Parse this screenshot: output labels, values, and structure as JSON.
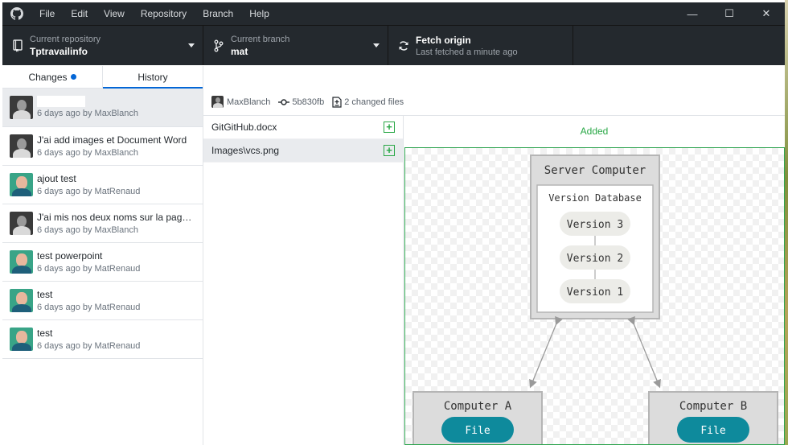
{
  "menu": [
    "File",
    "Edit",
    "View",
    "Repository",
    "Branch",
    "Help"
  ],
  "window_controls": {
    "minimize": "—",
    "maximize": "☐",
    "close": "✕"
  },
  "toolbar": {
    "repo_caption": "Current repository",
    "repo_name": "Tptravailinfo",
    "branch_caption": "Current branch",
    "branch_name": "mat",
    "fetch_title": "Fetch origin",
    "fetch_status": "Last fetched a minute ago"
  },
  "tabs": {
    "changes": "Changes",
    "history": "History",
    "selected": "History"
  },
  "commits": [
    {
      "summary": "",
      "meta": "6 days ago by MaxBlanch",
      "author": "MaxBlanch",
      "selected": true
    },
    {
      "summary": "J'ai add images et Document Word",
      "meta": "6 days ago by MaxBlanch",
      "author": "MaxBlanch"
    },
    {
      "summary": "ajout test",
      "meta": "6 days ago by MatRenaud",
      "author": "MatRenaud"
    },
    {
      "summary": "J'ai mis nos deux noms sur la page ...",
      "meta": "6 days ago by MaxBlanch",
      "author": "MaxBlanch"
    },
    {
      "summary": "test powerpoint",
      "meta": "6 days ago by MatRenaud",
      "author": "MatRenaud"
    },
    {
      "summary": "test",
      "meta": "6 days ago by MatRenaud",
      "author": "MatRenaud"
    },
    {
      "summary": "test",
      "meta": "6 days ago by MatRenaud",
      "author": "MatRenaud"
    }
  ],
  "commit_header": {
    "author": "MaxBlanch",
    "sha": "5b830fb",
    "changed_files": "2 changed files"
  },
  "files": [
    {
      "name": "GitGitHub.docx",
      "status": "+"
    },
    {
      "name": "Images\\vcs.png",
      "status": "+",
      "selected": true
    }
  ],
  "diff": {
    "label": "Added"
  },
  "image": {
    "server_title": "Server Computer",
    "db_title": "Version Database",
    "versions": [
      "Version 3",
      "Version 2",
      "Version 1"
    ],
    "computer_a": "Computer A",
    "computer_b": "Computer B",
    "file_label": "File"
  },
  "colors": {
    "accent": "#0366d6",
    "added": "#28a745",
    "titlebar": "#24292e",
    "file_pill": "#0e8a9c"
  }
}
